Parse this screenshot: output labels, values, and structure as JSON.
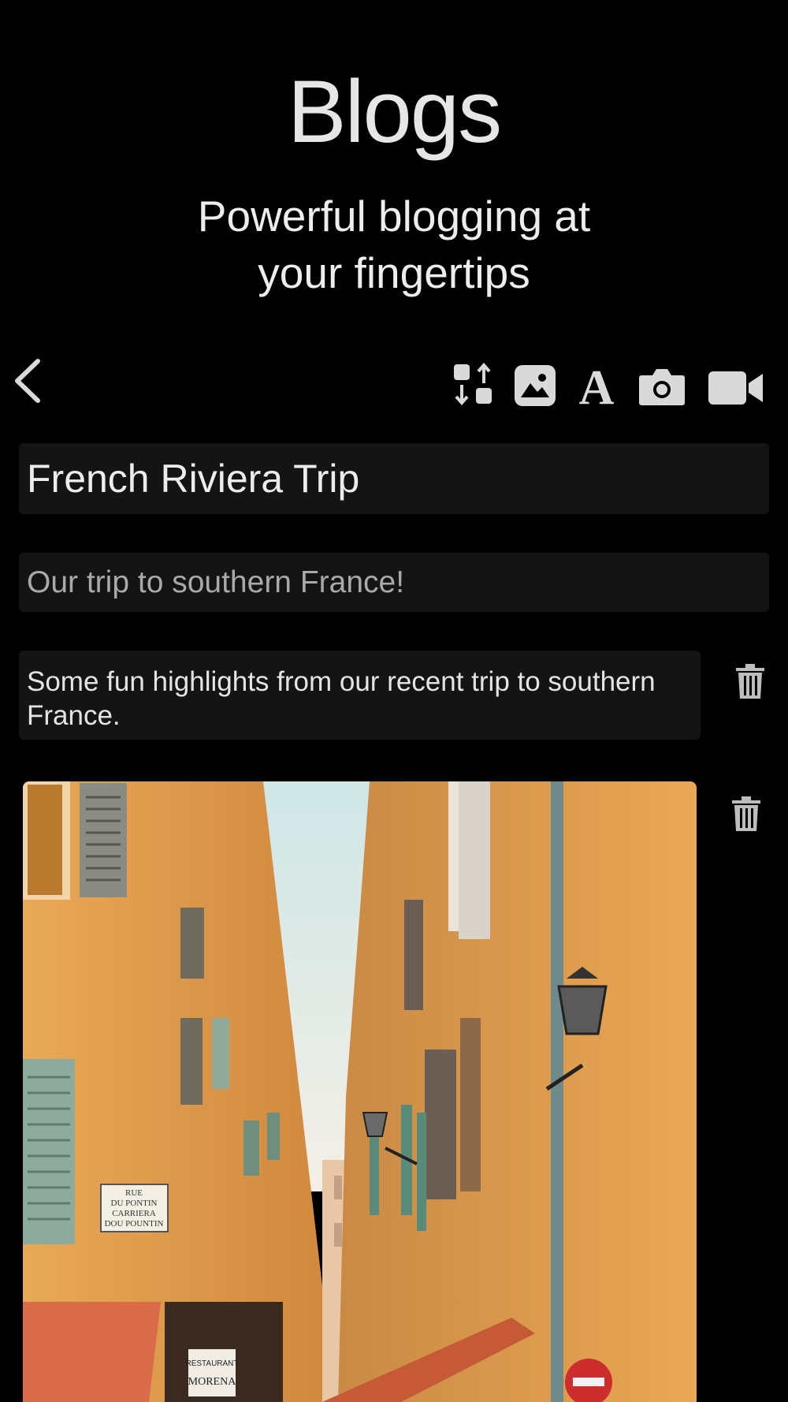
{
  "header": {
    "title": "Blogs",
    "subtitle_line1": "Powerful blogging at",
    "subtitle_line2": "your fingertips"
  },
  "toolbar": {
    "icons": [
      "chevron-left-icon",
      "reorder-icon",
      "image-icon",
      "text-icon",
      "camera-icon",
      "video-icon"
    ]
  },
  "post": {
    "title": "French Riviera Trip",
    "subtitle_placeholder": "Our trip to southern France!",
    "text_block": "Some fun highlights from our recent trip to southern France."
  },
  "photo": {
    "sign_lines": [
      "RUE",
      "DU PONTIN",
      "CARRIERA",
      "DOU POUNTIN"
    ],
    "restaurant_sign": "RESTAURANT",
    "restaurant_name": "MORENA"
  },
  "colors": {
    "background": "#000000",
    "field": "#141414",
    "icon": "#d9d9d9",
    "wall": "#e3a250"
  }
}
